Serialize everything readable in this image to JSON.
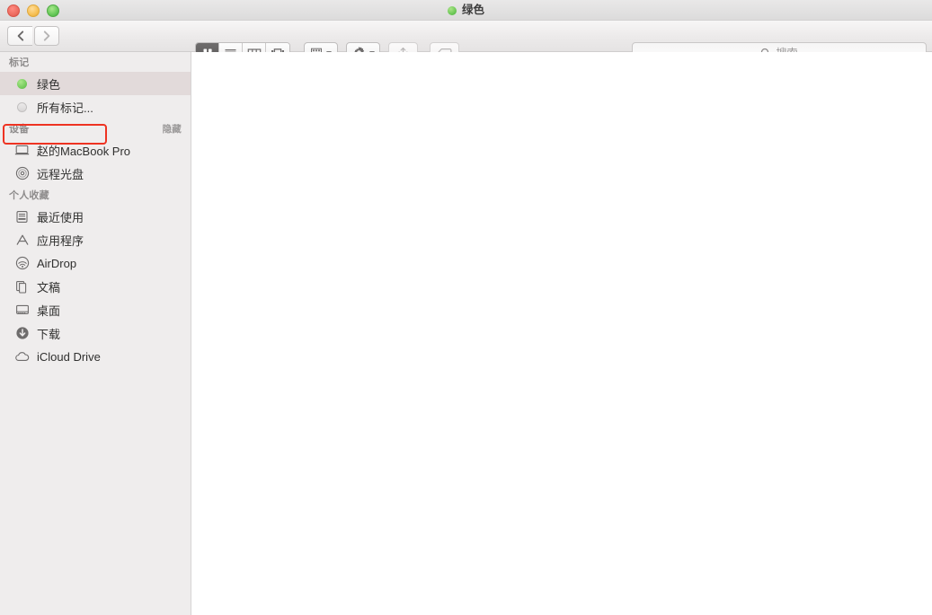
{
  "window": {
    "title": "绿色",
    "title_dot_color": "#62c24e",
    "traffic_lights": [
      {
        "name": "close",
        "color": "#ec6a5e"
      },
      {
        "name": "minimize",
        "color": "#f5bd4f"
      },
      {
        "name": "maximize",
        "color": "#61c555"
      }
    ]
  },
  "toolbar": {
    "back_label": "‹",
    "forward_label": "›",
    "view_modes": [
      {
        "name": "icon-view",
        "icon": "grid-icon",
        "active": true
      },
      {
        "name": "list-view",
        "icon": "list-icon",
        "active": false
      },
      {
        "name": "column-view",
        "icon": "columns-icon",
        "active": false
      },
      {
        "name": "gallery-view",
        "icon": "gallery-icon",
        "active": false
      }
    ],
    "arrange": {
      "icon": "arrange-grid-icon",
      "has_caret": true
    },
    "action": {
      "icon": "gear-icon",
      "has_caret": true
    },
    "share": {
      "icon": "share-icon",
      "enabled": false
    },
    "tags": {
      "icon": "tag-icon",
      "enabled": false
    }
  },
  "search": {
    "placeholder": "搜索",
    "value": "",
    "icon": "search-icon"
  },
  "sidebar": {
    "sections": [
      {
        "header": "标记",
        "hide_link": "",
        "items": [
          {
            "label": "绿色",
            "icon": "tag-dot-green",
            "selected": true
          },
          {
            "label": "所有标记...",
            "icon": "tag-dot-gray",
            "selected": false
          }
        ]
      },
      {
        "header": "设备",
        "hide_link": "隐藏",
        "items": [
          {
            "label": "赵的MacBook Pro",
            "icon": "laptop-icon",
            "selected": false
          },
          {
            "label": "远程光盘",
            "icon": "disc-icon",
            "selected": false
          }
        ]
      },
      {
        "header": "个人收藏",
        "hide_link": "",
        "items": [
          {
            "label": "最近使用",
            "icon": "recents-icon",
            "selected": false
          },
          {
            "label": "应用程序",
            "icon": "applications-icon",
            "selected": false
          },
          {
            "label": "AirDrop",
            "icon": "airdrop-icon",
            "selected": false
          },
          {
            "label": "文稿",
            "icon": "documents-icon",
            "selected": false
          },
          {
            "label": "桌面",
            "icon": "desktop-icon",
            "selected": false
          },
          {
            "label": "下载",
            "icon": "downloads-icon",
            "selected": false
          },
          {
            "label": "iCloud Drive",
            "icon": "cloud-icon",
            "selected": false
          }
        ]
      }
    ]
  },
  "content": {
    "empty": true,
    "items": []
  },
  "annotation": {
    "color": "#ee3322",
    "target": "绿色"
  }
}
